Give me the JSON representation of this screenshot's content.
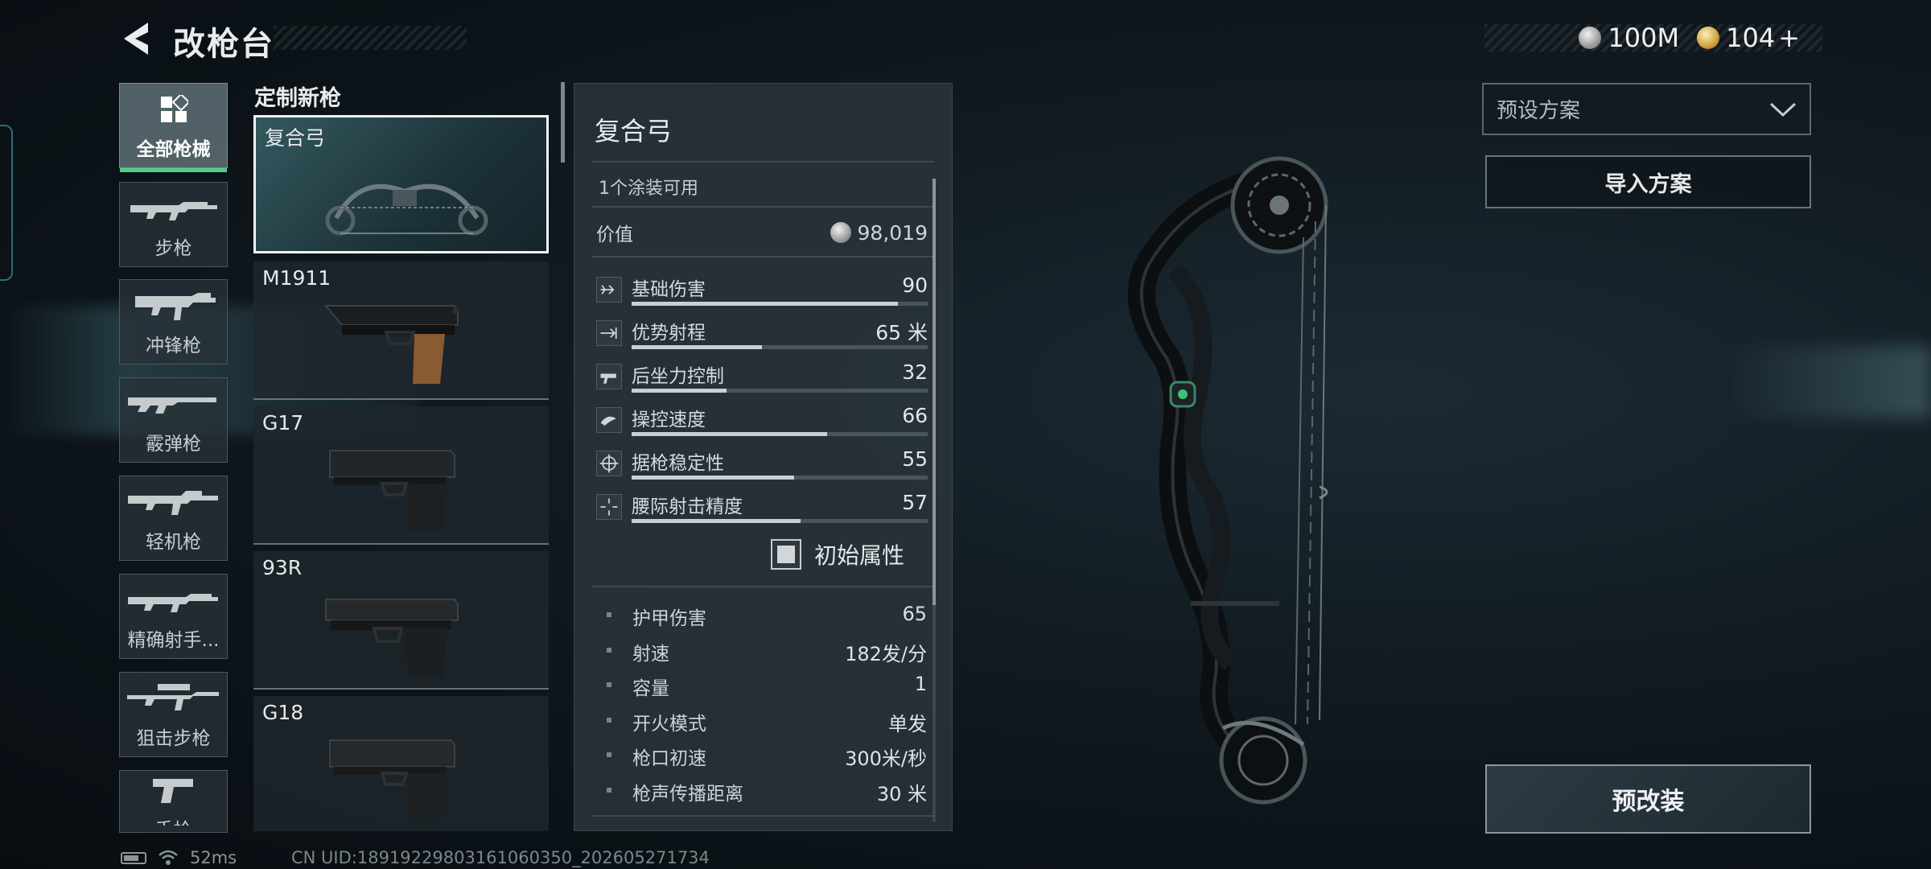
{
  "header": {
    "title": "改枪台"
  },
  "currency": {
    "silver": "100M",
    "gold": "104",
    "gold_plus": "+"
  },
  "categories": [
    {
      "label": "全部枪械",
      "icon": "grid-icon"
    },
    {
      "label": "步枪",
      "icon": "rifle-icon"
    },
    {
      "label": "冲锋枪",
      "icon": "smg-icon"
    },
    {
      "label": "霰弹枪",
      "icon": "shotgun-icon"
    },
    {
      "label": "轻机枪",
      "icon": "lmg-icon"
    },
    {
      "label": "精确射手...",
      "icon": "dmr-icon"
    },
    {
      "label": "狙击步枪",
      "icon": "sniper-icon"
    },
    {
      "label": "手枪",
      "icon": "pistol-icon"
    }
  ],
  "gun_list": {
    "heading": "定制新枪",
    "guns": [
      {
        "name": "复合弓"
      },
      {
        "name": "M1911"
      },
      {
        "name": "G17"
      },
      {
        "name": "93R"
      },
      {
        "name": "G18"
      }
    ]
  },
  "detail": {
    "title": "复合弓",
    "skins": "1个涂装可用",
    "value_label": "价值",
    "value": "98,019",
    "stats": [
      {
        "name": "基础伤害",
        "value": "90",
        "fill": 0.9,
        "icon": "damage-icon"
      },
      {
        "name": "优势射程",
        "value": "65 米",
        "fill": 0.44,
        "icon": "range-icon"
      },
      {
        "name": "后坐力控制",
        "value": "32",
        "fill": 0.32,
        "icon": "recoil-icon"
      },
      {
        "name": "操控速度",
        "value": "66",
        "fill": 0.66,
        "icon": "handling-icon"
      },
      {
        "name": "据枪稳定性",
        "value": "55",
        "fill": 0.55,
        "icon": "stability-icon"
      },
      {
        "name": "腰际射击精度",
        "value": "57",
        "fill": 0.57,
        "icon": "hipfire-icon"
      }
    ],
    "initial_toggle": "初始属性",
    "attributes": [
      {
        "name": "护甲伤害",
        "value": "65"
      },
      {
        "name": "射速",
        "value": "182发/分"
      },
      {
        "name": "容量",
        "value": "1"
      },
      {
        "name": "开火模式",
        "value": "单发"
      },
      {
        "name": "枪口初速",
        "value": "300米/秒"
      },
      {
        "name": "枪声传播距离",
        "value": "30 米"
      }
    ]
  },
  "right": {
    "preset_placeholder": "预设方案",
    "import_label": "导入方案",
    "premod_label": "预改装"
  },
  "status": {
    "ping": "52ms",
    "uid": "CN UID:18919229803161060350_202605271734"
  }
}
